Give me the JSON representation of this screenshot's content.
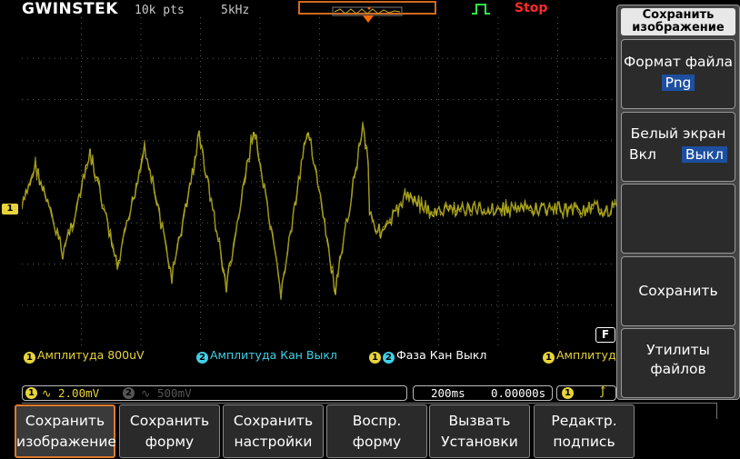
{
  "header": {
    "brand": "GWINSTEK",
    "record_length": "10k pts",
    "sample_rate": "5kHz",
    "run_status": "Stop",
    "trigger_icon": "trigger-pulse-icon"
  },
  "channel_marker": "1",
  "function_badge": "F",
  "measurements": [
    {
      "dot": "1",
      "text": "Амплитуда 800uV"
    },
    {
      "dot": "2",
      "text": "Амплитуда Кан Выкл"
    },
    {
      "dot": "12",
      "text": "Фаза Кан Выкл"
    },
    {
      "dot": "1",
      "text": "Амплитуда"
    }
  ],
  "status_bar": {
    "ch1_label": "1",
    "ch1_scale": "∿ 2.00mV",
    "ch2_label": "2",
    "ch2_scale": "∿ 500mV",
    "timebase": "200ms",
    "position": "0.00000s",
    "trigger_source": "1",
    "trigger_edge": "ƒ"
  },
  "bottom_menu": [
    {
      "line1": "Сохранить",
      "line2": "изображение",
      "selected": true
    },
    {
      "line1": "Сохранить",
      "line2": "форму",
      "selected": false
    },
    {
      "line1": "Сохранить",
      "line2": "настройки",
      "selected": false
    },
    {
      "line1": "Воспр.",
      "line2": "форму",
      "selected": false
    },
    {
      "line1": "Вызвать",
      "line2": "Установки",
      "selected": false
    },
    {
      "line1": "Редактр.",
      "line2": "подпись",
      "selected": false
    }
  ],
  "side_menu": {
    "title_line1": "Сохранить",
    "title_line2": "изображение",
    "file_format_label": "Формат файла",
    "file_format_value": "Png",
    "white_screen_label": "Белый экран",
    "white_screen_on": "Вкл",
    "white_screen_off": "Выкл",
    "save_label": "Сохранить",
    "utilities_line1": "Утилиты",
    "utilities_line2": "файлов"
  },
  "colors": {
    "ch1": "#e8d43a",
    "ch2": "#3fd0e8",
    "trace": "#b8b020",
    "accent": "#e07b2a",
    "stop": "#ff2a2a"
  }
}
